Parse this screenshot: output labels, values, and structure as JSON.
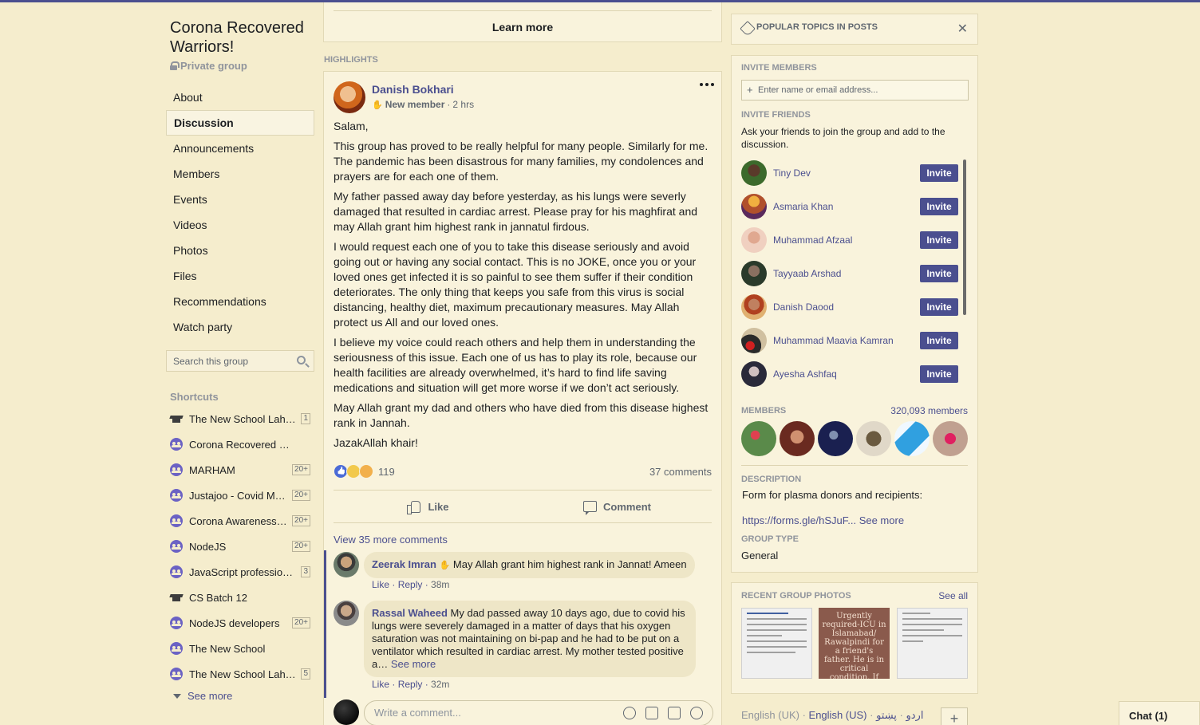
{
  "group": {
    "title": "Corona Recovered Warriors!",
    "privacy": "Private group"
  },
  "nav": {
    "items": [
      "About",
      "Discussion",
      "Announcements",
      "Members",
      "Events",
      "Videos",
      "Photos",
      "Files",
      "Recommendations",
      "Watch party"
    ],
    "active": "Discussion",
    "search_placeholder": "Search this group"
  },
  "shortcuts": {
    "heading": "Shortcuts",
    "items": [
      {
        "label": "The New School Lah…",
        "badge": "1",
        "icon": "school-cap-icon"
      },
      {
        "label": "Corona Recovered War…",
        "badge": "",
        "icon": "group-icon"
      },
      {
        "label": "MARHAM",
        "badge": "20+",
        "icon": "group-icon"
      },
      {
        "label": "Justajoo - Covid M…",
        "badge": "20+",
        "icon": "group-icon"
      },
      {
        "label": "Corona Awareness…",
        "badge": "20+",
        "icon": "group-icon"
      },
      {
        "label": "NodeJS",
        "badge": "20+",
        "icon": "group-icon"
      },
      {
        "label": "JavaScript professio…",
        "badge": "3",
        "icon": "group-icon"
      },
      {
        "label": "CS Batch 12",
        "badge": "",
        "icon": "school-cap-icon"
      },
      {
        "label": "NodeJS developers",
        "badge": "20+",
        "icon": "group-icon"
      },
      {
        "label": "The New School",
        "badge": "",
        "icon": "group-icon"
      },
      {
        "label": "The New School Lah…",
        "badge": "5",
        "icon": "group-icon"
      }
    ],
    "see_more": "See more"
  },
  "feed": {
    "learn_more": "Learn more",
    "highlights": "HIGHLIGHTS"
  },
  "post": {
    "author": "Danish Bokhari",
    "badge": "New member",
    "time": "2 hrs",
    "paragraphs": [
      "Salam,",
      "This group has proved to be really helpful for many people. Similarly for me. The pandemic has been disastrous for many families, my condolences and prayers are for each one of them.",
      "My father passed away day before yesterday, as his lungs were severly damaged that resulted in cardiac arrest. Please pray for his maghfirat and may Allah grant him highest rank in jannatul firdous.",
      "I would request each one of you to take this disease seriously and avoid going out or having any social contact. This is no JOKE, once you or your loved ones get infected it is so painful to see them suffer if their condition deteriorates. The only thing that keeps you safe from this virus is social distancing, healthy diet, maximum precautionary measures. May Allah protect us All and our loved ones.",
      "I believe my voice could reach others and help them in understanding the seriousness of this issue. Each one of us has to play its role, because our health facilities are already overwhelmed, it’s hard to find life saving medications and situation will get more worse if we don’t act seriously.",
      "May Allah grant my dad and others who have died from this disease highest rank in Jannah.",
      "JazakAllah khair!"
    ],
    "reactions_count": "119",
    "comments_count": "37 comments",
    "like_label": "Like",
    "comment_label": "Comment",
    "view_more": "View 35 more comments",
    "comments": [
      {
        "name": "Zeerak Imran",
        "text": "May Allah grant him highest rank in Jannat! Ameen",
        "like": "Like",
        "reply": "Reply",
        "time": "38m"
      },
      {
        "name": "Rassal Waheed",
        "text": "My dad passed away 10 days ago, due to covid his lungs were severely damaged in a matter of days that his oxygen saturation was not maintaining on bi-pap and he had to be put on a ventilator which resulted in cardiac arrest. My mother tested positive a…",
        "see_more": "See more",
        "like": "Like",
        "reply": "Reply",
        "time": "32m"
      }
    ],
    "write_placeholder": "Write a comment..."
  },
  "sidebar": {
    "topics_title": "POPULAR TOPICS IN POSTS",
    "invite_members": "INVITE MEMBERS",
    "invite_placeholder": "Enter name or email address...",
    "invite_friends": "INVITE FRIENDS",
    "invite_desc": "Ask your friends to join the group and add to the discussion.",
    "invite_label": "Invite",
    "friends": [
      "Tiny Dev",
      "Asmaria Khan",
      "Muhammad Afzaal",
      "Tayyaab Arshad",
      "Danish Daood",
      "Muhammad Maavia Kamran",
      "Ayesha Ashfaq"
    ],
    "members_heading": "MEMBERS",
    "members_count": "320,093 members",
    "description_heading": "DESCRIPTION",
    "description": "Form for plasma donors and recipients:",
    "description_link": "https://forms.gle/hSJuF...",
    "see_more": "See more",
    "group_type_heading": "GROUP TYPE",
    "group_type": "General",
    "photos_heading": "RECENT GROUP PHOTOS",
    "see_all": "See all",
    "photo_text": "Urgently required-ICU in Islamabad/ Rawalpindi for a friend's father. He is in critical condition. If anyone knows any hospital with space in ICU please"
  },
  "footer": {
    "lang_current": "English (UK)",
    "lang_links": [
      "English (US)",
      "اردو",
      "پښتو"
    ],
    "chat": "Chat (1)"
  }
}
